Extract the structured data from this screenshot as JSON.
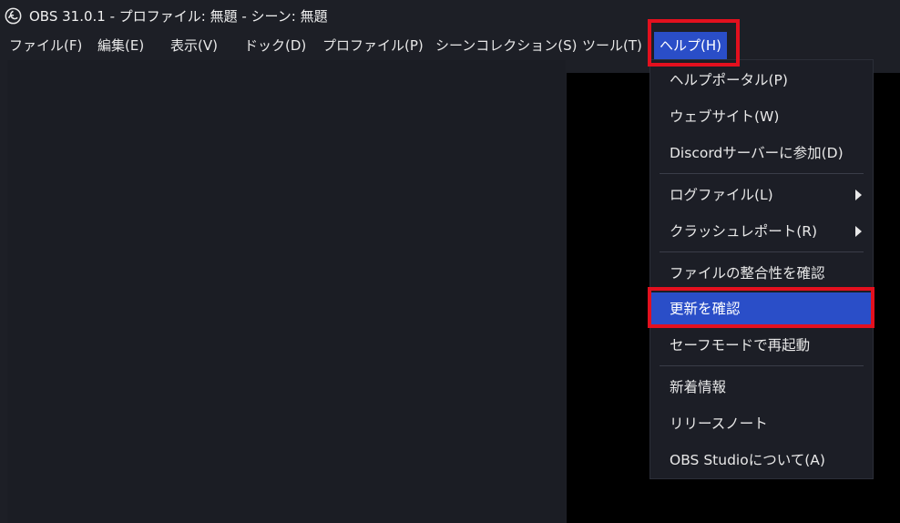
{
  "window": {
    "title": "OBS 31.0.1 - プロファイル: 無題 - シーン: 無題",
    "icon": "obs-logo-icon"
  },
  "menubar": {
    "items": [
      {
        "label": "ファイル(F)"
      },
      {
        "label": "編集(E)"
      },
      {
        "label": "表示(V)"
      },
      {
        "label": "ドック(D)"
      },
      {
        "label": "プロファイル(P)"
      },
      {
        "label": "シーンコレクション(S)"
      },
      {
        "label": "ツール(T)"
      },
      {
        "label": "ヘルプ(H)"
      }
    ]
  },
  "help_menu": {
    "items": [
      {
        "label": "ヘルプポータル(P)"
      },
      {
        "label": "ウェブサイト(W)"
      },
      {
        "label": "Discordサーバーに参加(D)"
      },
      {
        "label": "ログファイル(L)",
        "submenu": true
      },
      {
        "label": "クラッシュレポート(R)",
        "submenu": true
      },
      {
        "label": "ファイルの整合性を確認"
      },
      {
        "label": "更新を確認",
        "selected": true
      },
      {
        "label": "セーフモードで再起動"
      },
      {
        "label": "新着情報"
      },
      {
        "label": "リリースノート"
      },
      {
        "label": "OBS Studioについて(A)"
      }
    ]
  },
  "colors": {
    "background": "#1d1f26",
    "highlight": "#2a4ec8",
    "annotation": "#e3101e",
    "preview": "#000000"
  }
}
